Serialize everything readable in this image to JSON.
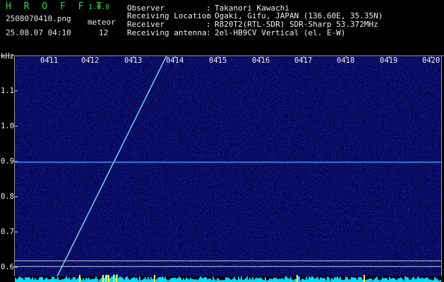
{
  "header": {
    "app_title": "H R O F F T",
    "version": "1.0.0",
    "filename": "2508070410.png",
    "timestamp": "25.08.07 04:10",
    "meteor_label": "meteor",
    "meteor_count": "12",
    "info": [
      {
        "label": "Observer",
        "value": "Takanori Kawachi"
      },
      {
        "label": "Receiving Location",
        "value": "Ogaki, Gifu, JAPAN (136.60E, 35.35N)"
      },
      {
        "label": "Receiver",
        "value": "R820T2(RTL-SDR) SDR-Sharp 53.372MHz"
      },
      {
        "label": "Receiving antenna",
        "value": "2el-HB9CV Vertical (el. E-W)"
      }
    ],
    "colon": ":"
  },
  "chart_data": {
    "type": "heatmap",
    "title": "",
    "y_unit_label": "kHz",
    "x_ticks": [
      "0411",
      "0412",
      "0413",
      "0414",
      "0415",
      "0416",
      "0417",
      "0418",
      "0419",
      "0420"
    ],
    "y_ticks": [
      "1.1",
      "1.0",
      "0.9",
      "0.8",
      "0.7",
      "0.6"
    ],
    "y_tick_values": [
      1.1,
      1.0,
      0.9,
      0.8,
      0.7,
      0.6
    ],
    "colors": {
      "background": "#020250",
      "noise": "#1a2cc0",
      "carrier": "#3a9cff",
      "meteor_trail": "#7ad8ff",
      "level_bar": "#00dcff",
      "level_peak": "#ffff40",
      "frame": "#c8c8c8"
    }
  }
}
